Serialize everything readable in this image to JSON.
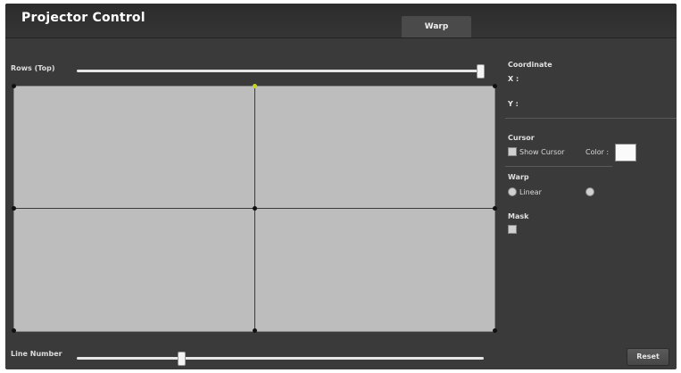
{
  "app": {
    "title": "Projector Control"
  },
  "tabs": [
    {
      "label": ""
    },
    {
      "label": "Warp",
      "active": true
    },
    {
      "label": ""
    },
    {
      "label": ""
    }
  ],
  "warp": {
    "rows_label": "Rows (Top)",
    "rows_value_fraction": 1.0,
    "lines_label": "Line Number",
    "lines_value_fraction": 0.35
  },
  "coordinate": {
    "title": "Coordinate",
    "x_key": "X :",
    "x_value": "",
    "y_key": "Y :",
    "y_value": ""
  },
  "cursor": {
    "title": "Cursor",
    "show_label": "Show Cursor",
    "color_label": "Color :",
    "color_hex": "#fafafa"
  },
  "mode": {
    "title": "Warp",
    "opt_linear": "Linear",
    "opt_bezier": ""
  },
  "mask": {
    "title": "Mask",
    "option": ""
  },
  "buttons": {
    "reset": "Reset"
  },
  "colors": {
    "accent": "#c8e01a",
    "bg": "#3a3a3a",
    "canvas": "#bdbdbd"
  }
}
